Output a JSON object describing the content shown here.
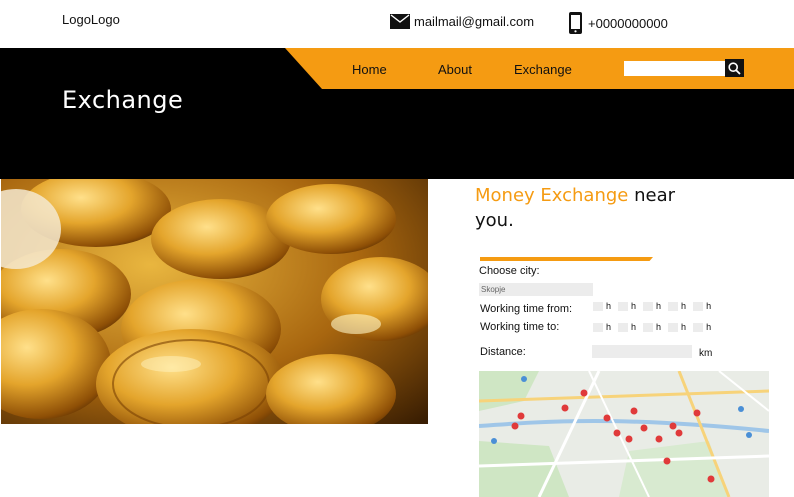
{
  "header": {
    "logo": "LogoLogo",
    "email": "mailmail@gmail.com",
    "phone": "+0000000000"
  },
  "nav": {
    "items": [
      "Home",
      "About",
      "Exchange"
    ],
    "search_value": ""
  },
  "page": {
    "title": "Exchange"
  },
  "finder": {
    "headline_accent": "Money Exchange",
    "headline_rest": " near you.",
    "city_label": "Choose city:",
    "city_value": "Skopje",
    "from_label": "Working time from:",
    "to_label": "Working time to:",
    "hour_unit": "h",
    "distance_label": "Distance:",
    "distance_unit": "km"
  },
  "colors": {
    "accent": "#f59b12",
    "header_bg": "#000000",
    "field_bg": "#ececec"
  },
  "icons": {
    "mail": "envelope-icon",
    "phone": "smartphone-icon",
    "search": "magnifier-icon",
    "pin": "map-pin-icon"
  }
}
